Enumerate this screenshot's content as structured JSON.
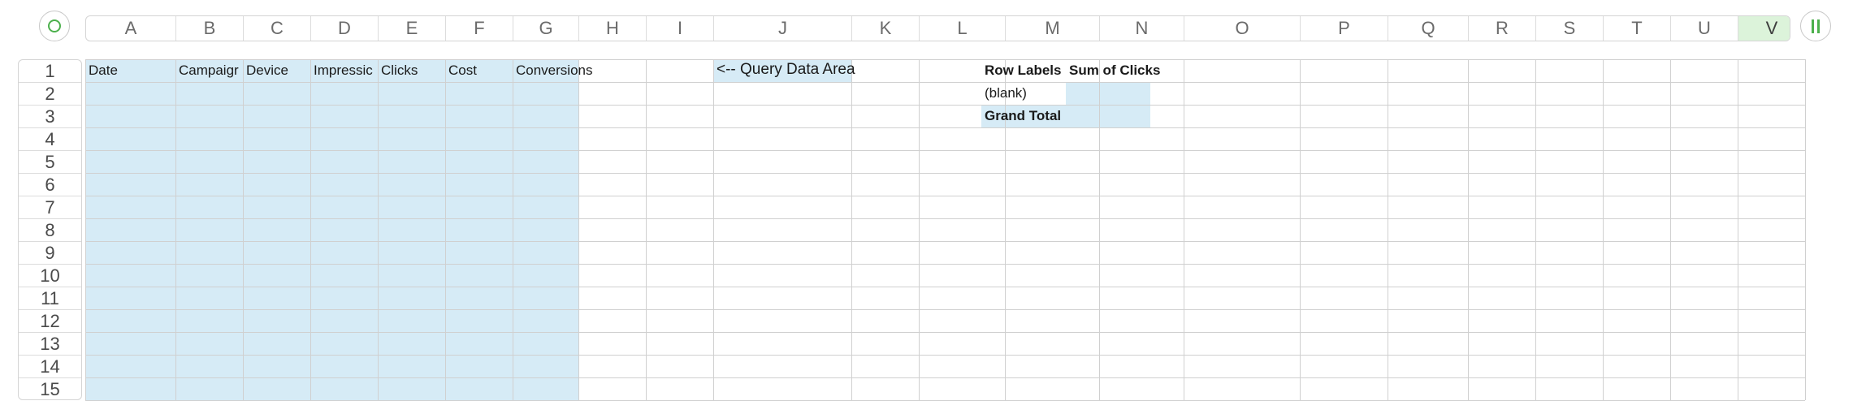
{
  "columns": [
    "A",
    "B",
    "C",
    "D",
    "E",
    "F",
    "G",
    "H",
    "I",
    "J",
    "K",
    "L",
    "M",
    "N",
    "O",
    "P",
    "Q",
    "R",
    "S",
    "T",
    "U",
    "V"
  ],
  "selected_column": "V",
  "rows": [
    "1",
    "2",
    "3",
    "4",
    "5",
    "6",
    "7",
    "8",
    "9",
    "10",
    "11",
    "12",
    "13",
    "14",
    "15"
  ],
  "headers": {
    "date": "Date",
    "campaign": "Campaigr",
    "device": "Device",
    "impressions": "Impressic",
    "clicks": "Clicks",
    "cost": "Cost",
    "conversions": "Conversions"
  },
  "query_note": "<-- Query Data Area",
  "pivot": {
    "row_labels": "Row Labels",
    "sum_of_clicks": "Sum of Clicks",
    "blank": "(blank)",
    "grand_total": "Grand Total"
  },
  "colors": {
    "accent_green": "#4cb04c",
    "query_fill": "#d6ebf6",
    "selected_header": "#dcf3da"
  }
}
